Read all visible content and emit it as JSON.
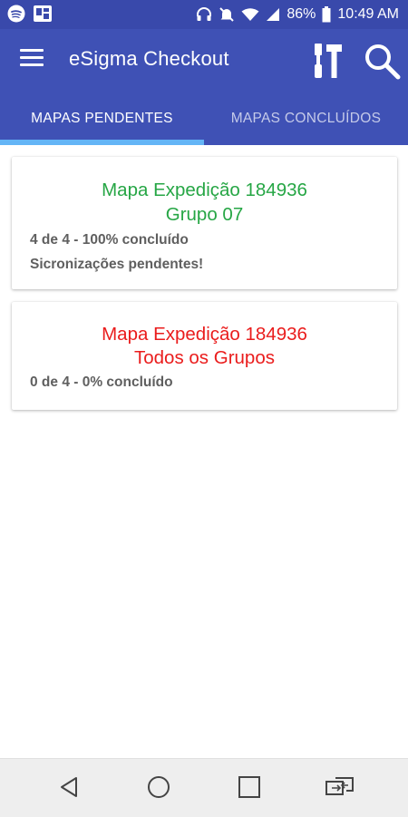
{
  "status_bar": {
    "battery_percent": "86%",
    "time": "10:49 AM",
    "color": "#3949ab"
  },
  "app_bar": {
    "title": "eSigma Checkout",
    "color": "#3f51b5"
  },
  "tabs": [
    {
      "label": "MAPAS PENDENTES",
      "active": true
    },
    {
      "label": "MAPAS CONCLUÍDOS",
      "active": false
    }
  ],
  "cards": [
    {
      "title": "Mapa Expedição 184936",
      "subtitle": "Grupo 07",
      "progress": "4 de 4 - 100% concluído",
      "note": "Sicronizações pendentes!",
      "color": "#26a645"
    },
    {
      "title": "Mapa Expedição 184936",
      "subtitle": "Todos os Grupos",
      "progress": "0 de 4 - 0% concluído",
      "color": "#ea1c1c"
    }
  ],
  "icons": {
    "status_left": [
      "spotify-icon",
      "sim-card-icon"
    ],
    "status_right": [
      "headphones-icon",
      "mute-icon",
      "wifi-icon",
      "signal-icon",
      "battery-icon"
    ],
    "app_bar": [
      "menu-icon",
      "tools-icon",
      "search-icon"
    ],
    "nav_bar": [
      "back-icon",
      "home-icon",
      "recents-icon",
      "switch-app-icon"
    ]
  }
}
